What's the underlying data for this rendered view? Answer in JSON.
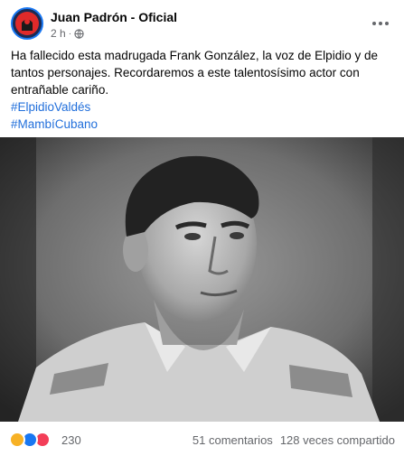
{
  "post": {
    "page_name": "Juan Padrón - Oficial",
    "time": "2 h",
    "separator": "·",
    "text": "Ha fallecido esta madrugada Frank González, la voz de Elpidio y de tantos personajes. Recordaremos a este talentosísimo actor con entrañable cariño.",
    "hashtags": [
      "#ElpidioValdés",
      "#MambíCubano"
    ],
    "reactions": {
      "types": [
        "sad",
        "like",
        "love"
      ],
      "count": "230"
    },
    "comments": "51 comentarios",
    "shares": "128 veces compartido"
  },
  "colors": {
    "link": "#216fdb",
    "muted": "#65676b",
    "like": "#1877f2",
    "love": "#f33e58",
    "sad": "#f7b125"
  },
  "icons": {
    "avatar": "page-logo-icon",
    "privacy": "globe-icon",
    "menu": "more-options-icon"
  }
}
